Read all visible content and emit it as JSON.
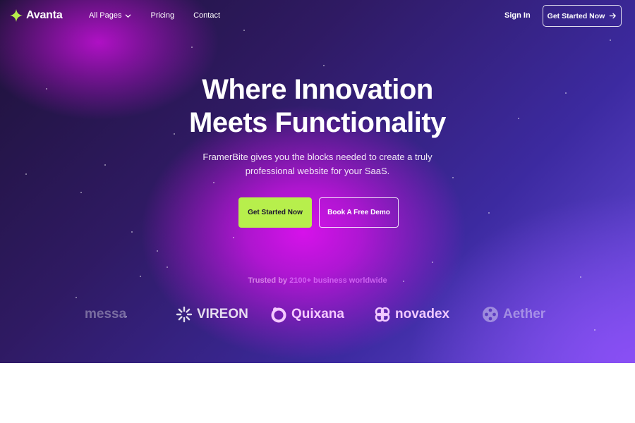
{
  "brand": {
    "name": "Avanta",
    "accent": "#b7ef4c"
  },
  "nav": {
    "links": [
      "All Pages",
      "Pricing",
      "Contact"
    ],
    "sign_in": "Sign In",
    "cta": "Get Started Now"
  },
  "hero": {
    "headline_line1": "Where Innovation",
    "headline_line2": "Meets Functionality",
    "subtitle_line1": "FramerBite gives you the blocks needed to create a truly",
    "subtitle_line2": "professional website for your SaaS.",
    "primary_cta": "Get Started Now",
    "secondary_cta": "Book A Free Demo"
  },
  "trusted": {
    "prefix": "Trusted by",
    "highlight": "2100+ business worldwide"
  },
  "logos": [
    "messa",
    "VIREON",
    "Quixana",
    "novadex",
    "Aether"
  ]
}
